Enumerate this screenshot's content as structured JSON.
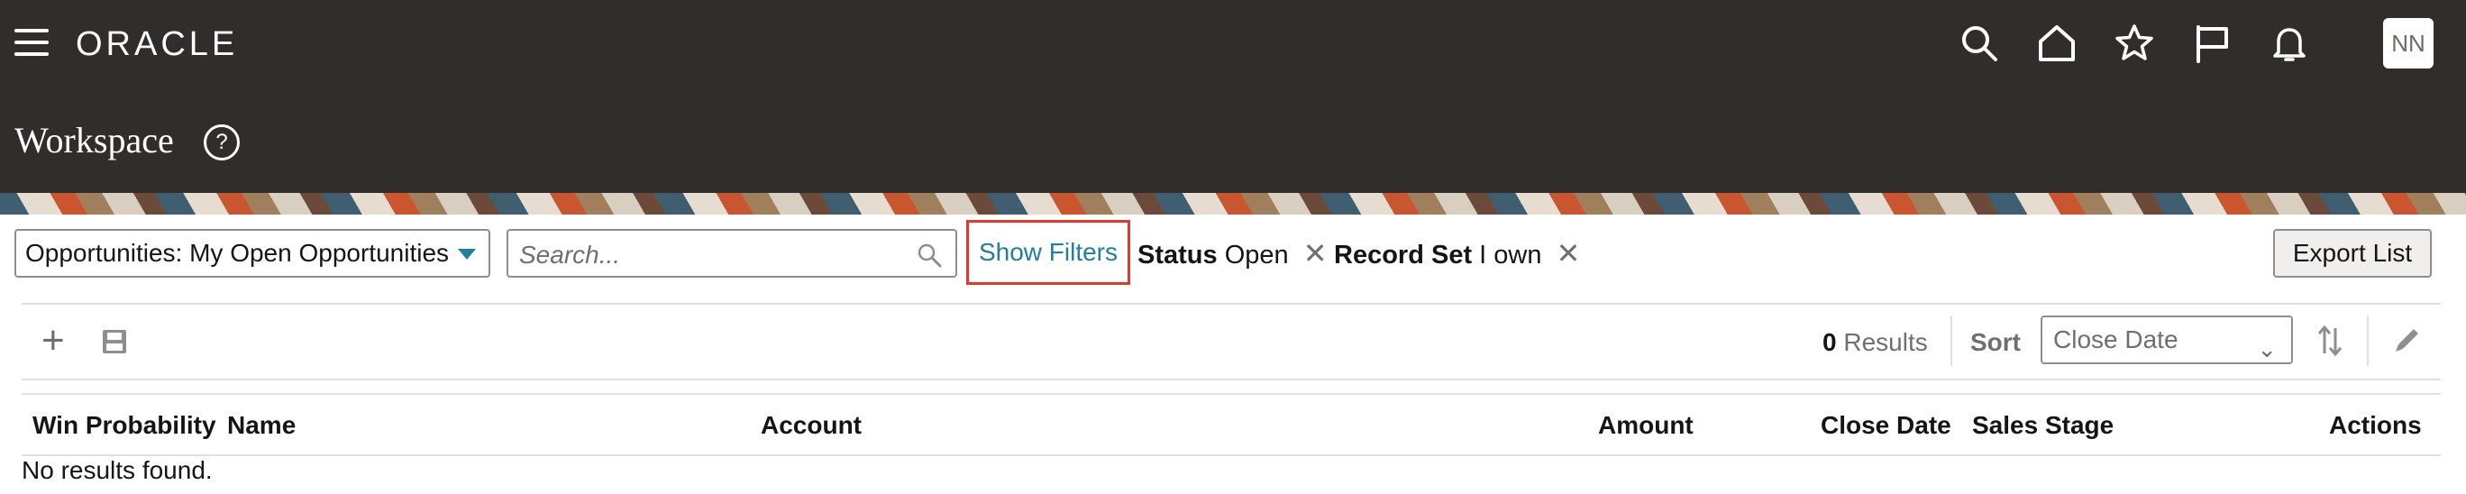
{
  "header": {
    "logo": "ORACLE",
    "page_title": "Workspace",
    "help_glyph": "?",
    "avatar_initials": "NN",
    "icons": [
      "menu-icon",
      "search-icon",
      "home-icon",
      "star-icon",
      "flag-icon",
      "bell-icon"
    ]
  },
  "toolbar": {
    "saved_search": "Opportunities: My Open Opportunities",
    "search_placeholder": "Search...",
    "show_filters": "Show Filters",
    "filters": [
      {
        "label": "Status",
        "value": "Open"
      },
      {
        "label": "Record Set",
        "value": "I own"
      }
    ],
    "remove_glyph": "✕",
    "export_label": "Export List"
  },
  "actions": {
    "results_count": "0",
    "results_label": "Results",
    "sort_label": "Sort",
    "sort_value": "Close Date"
  },
  "table": {
    "columns": [
      "Win Probability",
      "Name",
      "Account",
      "Amount",
      "Close Date",
      "Sales Stage",
      "Actions"
    ],
    "empty_message": "No results found."
  },
  "colors": {
    "header_bg": "#312d2a",
    "link": "#227e9e",
    "highlight_border": "#e8362a"
  }
}
